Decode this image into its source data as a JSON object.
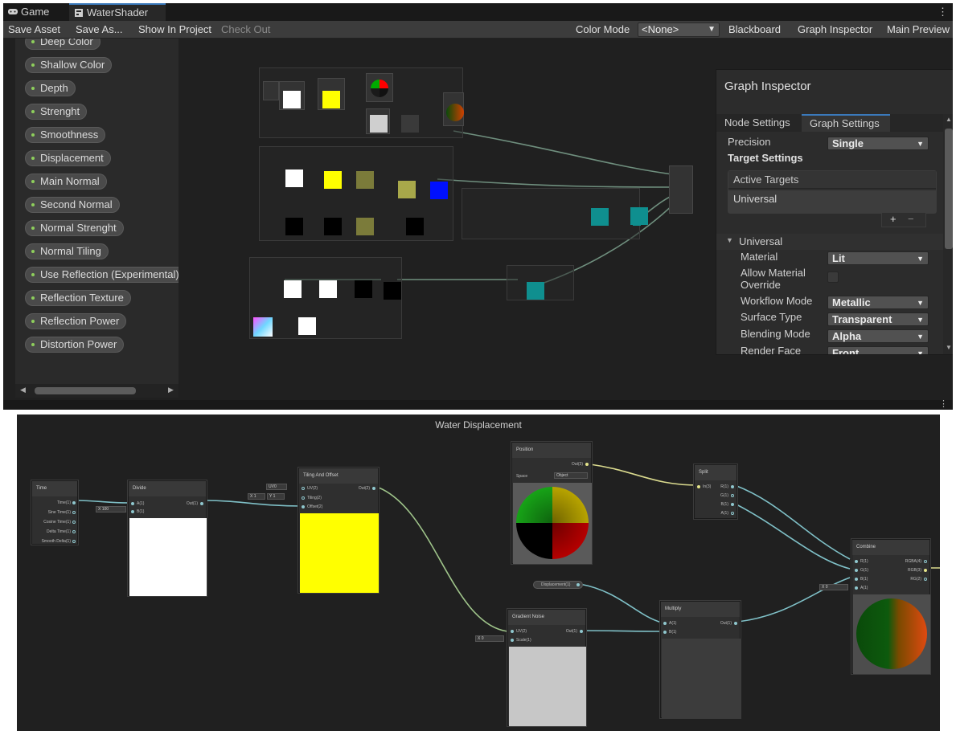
{
  "tabs": [
    {
      "label": "Game",
      "icon": "gamepad-icon"
    },
    {
      "label": "WaterShader",
      "icon": "shader-graph-icon"
    }
  ],
  "toolbar": {
    "save_asset": "Save Asset",
    "save_as": "Save As...",
    "show_in_project": "Show In Project",
    "check_out": "Check Out",
    "color_mode_label": "Color Mode",
    "color_mode_value": "<None>",
    "blackboard": "Blackboard",
    "graph_inspector": "Graph Inspector",
    "main_preview": "Main Preview"
  },
  "blackboard": {
    "properties": [
      "Deep Color",
      "Shallow Color",
      "Depth",
      "Strenght",
      "Smoothness",
      "Displacement",
      "Main Normal",
      "Second Normal",
      "Normal Strenght",
      "Normal Tiling",
      "Use Reflection (Experimental)",
      "Reflection Texture",
      "Reflection Power",
      "Distortion Power"
    ]
  },
  "inspector": {
    "title": "Graph Inspector",
    "tabs": [
      "Node Settings",
      "Graph Settings"
    ],
    "active_tab": "Graph Settings",
    "precision_label": "Precision",
    "precision_value": "Single",
    "target_settings": "Target Settings",
    "active_targets": "Active Targets",
    "target_item": "Universal",
    "add": "+",
    "remove": "−",
    "universal_section": "Universal",
    "material_label": "Material",
    "material_value": "Lit",
    "allow_override_label": "Allow Material Override",
    "workflow_label": "Workflow Mode",
    "workflow_value": "Metallic",
    "surface_label": "Surface Type",
    "surface_value": "Transparent",
    "blending_label": "Blending Mode",
    "blending_value": "Alpha",
    "render_face_label": "Render Face",
    "render_face_value": "Front"
  },
  "graph2": {
    "title": "Water Displacement",
    "time": {
      "title": "Time",
      "ports": [
        "Time(1)",
        "Sine Time(1)",
        "Cosine Time(1)",
        "Delta Time(1)",
        "Smooth Delta(1)"
      ]
    },
    "divide": {
      "title": "Divide",
      "in_a": "A(1)",
      "in_b": "B(1)",
      "out": "Out(1)",
      "b_value": "X 100"
    },
    "tiling": {
      "title": "Tiling And Offset",
      "uv": "UV(2)",
      "tiling": "Tiling(2)",
      "offset": "Offset(2)",
      "out": "Out(2)",
      "uv_field": "UV0",
      "tiling_x": "X 1",
      "tiling_y": "Y 1"
    },
    "position": {
      "title": "Position",
      "out": "Out(3)",
      "space_label": "Space",
      "space_value": "Object"
    },
    "split": {
      "title": "Split",
      "in": "In(3)",
      "outs": [
        "R(1)",
        "G(1)",
        "B(1)",
        "A(1)"
      ]
    },
    "displacement_prop": "Displacement(1)",
    "gradient": {
      "title": "Gradient Noise",
      "uv": "UV(2)",
      "scale": "Scale(1)",
      "out": "Out(1)",
      "scale_field": "X 0"
    },
    "multiply": {
      "title": "Multiply",
      "in_a": "A(1)",
      "in_b": "B(1)",
      "out": "Out(1)"
    },
    "combine": {
      "title": "Combine",
      "ins": [
        "R(1)",
        "G(1)",
        "B(1)",
        "A(1)"
      ],
      "outs": [
        "RGBA(4)",
        "RGB(3)",
        "RG(2)"
      ],
      "a_field": "X 0"
    }
  }
}
